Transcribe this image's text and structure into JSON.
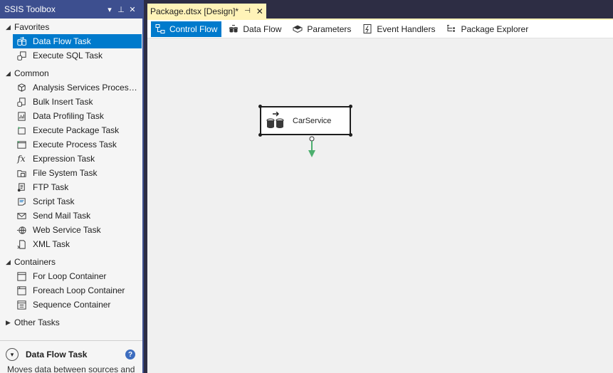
{
  "toolbox": {
    "title": "SSIS Toolbox",
    "controls": {
      "dropdown": "▾",
      "pin": "⊥",
      "close": "✕"
    },
    "groups": [
      {
        "label": "Favorites",
        "expanded": true,
        "items": [
          {
            "label": "Data Flow Task",
            "icon": "data-flow-icon",
            "selected": true
          },
          {
            "label": "Execute SQL Task",
            "icon": "execute-sql-icon"
          }
        ]
      },
      {
        "label": "Common",
        "expanded": true,
        "items": [
          {
            "label": "Analysis Services Processing Task",
            "icon": "cube-icon"
          },
          {
            "label": "Bulk Insert Task",
            "icon": "bulk-insert-icon"
          },
          {
            "label": "Data Profiling Task",
            "icon": "data-profiling-icon"
          },
          {
            "label": "Execute Package Task",
            "icon": "execute-package-icon"
          },
          {
            "label": "Execute Process Task",
            "icon": "execute-process-icon"
          },
          {
            "label": "Expression Task",
            "icon": "fx-icon"
          },
          {
            "label": "File System Task",
            "icon": "file-system-icon"
          },
          {
            "label": "FTP Task",
            "icon": "ftp-icon"
          },
          {
            "label": "Script Task",
            "icon": "script-icon"
          },
          {
            "label": "Send Mail Task",
            "icon": "mail-icon"
          },
          {
            "label": "Web Service Task",
            "icon": "globe-icon"
          },
          {
            "label": "XML Task",
            "icon": "xml-icon"
          }
        ]
      },
      {
        "label": "Containers",
        "expanded": true,
        "items": [
          {
            "label": "For Loop Container",
            "icon": "for-loop-icon"
          },
          {
            "label": "Foreach Loop Container",
            "icon": "foreach-loop-icon"
          },
          {
            "label": "Sequence Container",
            "icon": "sequence-icon"
          }
        ]
      },
      {
        "label": "Other Tasks",
        "expanded": false,
        "items": []
      }
    ],
    "info": {
      "title": "Data Flow Task",
      "help": "?",
      "description": "Moves data between sources and destinations"
    }
  },
  "document": {
    "tab_title": "Package.dtsx [Design]*",
    "tab_pin": "⊣",
    "tab_close": "✕",
    "designer_tabs": [
      {
        "label": "Control Flow",
        "icon": "control-flow-icon",
        "active": true
      },
      {
        "label": "Data Flow",
        "icon": "data-flow-tab-icon"
      },
      {
        "label": "Parameters",
        "icon": "parameters-icon"
      },
      {
        "label": "Event Handlers",
        "icon": "event-handlers-icon"
      },
      {
        "label": "Package Explorer",
        "icon": "package-explorer-icon"
      }
    ],
    "task": {
      "label": "CarService",
      "icon": "data-flow-icon"
    }
  },
  "colors": {
    "title_bar": "#3d4f8f",
    "selection": "#007acc",
    "doc_tab": "#fff3b8",
    "canvas": "#f0f0f0",
    "connector": "#4caf6e"
  }
}
